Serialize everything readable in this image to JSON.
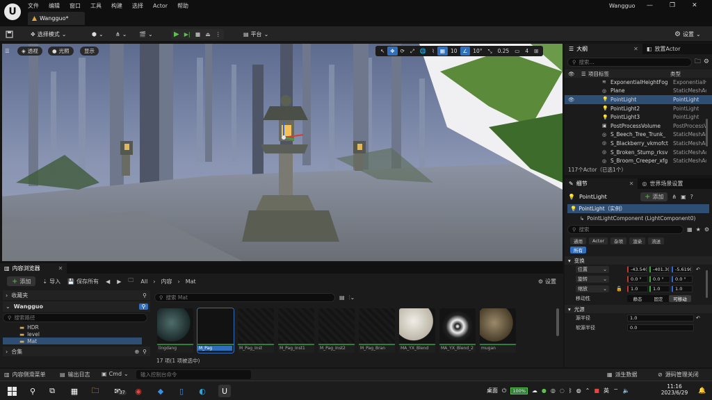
{
  "app": {
    "menu": [
      "文件",
      "编辑",
      "窗口",
      "工具",
      "构建",
      "选择",
      "Actor",
      "帮助"
    ],
    "doc_tab": "Wangguo*",
    "project_name": "Wangguo"
  },
  "toolbar": {
    "select_mode": "选择模式",
    "platform": "平台",
    "settings": "设置"
  },
  "viewport": {
    "perspective": "透视",
    "lit": "光照",
    "show": "显示",
    "grid_snap": "10",
    "rot_snap": "10°",
    "scale_snap": "0.25",
    "camera_speed": "4"
  },
  "outliner": {
    "tab_outliner": "大纲",
    "tab_place": "放置Actor",
    "search_placeholder": "搜索...",
    "col_label": "项目标签",
    "col_type": "类型",
    "rows": [
      {
        "name": "ExponentialHeightFog",
        "type": "ExponentialHeightFog",
        "icon": "fog-icon"
      },
      {
        "name": "Plane",
        "type": "StaticMeshActor",
        "icon": "mesh-icon"
      },
      {
        "name": "PointLight",
        "type": "PointLight",
        "icon": "light-icon",
        "selected": true
      },
      {
        "name": "PointLight2",
        "type": "PointLight",
        "icon": "light-icon"
      },
      {
        "name": "PointLight3",
        "type": "PointLight",
        "icon": "light-icon"
      },
      {
        "name": "PostProcessVolume",
        "type": "PostProcessVolume",
        "icon": "volume-icon"
      },
      {
        "name": "S_Beech_Tree_Trunk_",
        "type": "StaticMeshActor",
        "icon": "mesh-icon"
      },
      {
        "name": "S_Blackberry_vkmofct",
        "type": "StaticMeshActor",
        "icon": "mesh-icon"
      },
      {
        "name": "S_Broken_Stump_rksv",
        "type": "StaticMeshActor",
        "icon": "mesh-icon"
      },
      {
        "name": "S_Broom_Creeper_xfg",
        "type": "StaticMeshActor",
        "icon": "mesh-icon"
      }
    ],
    "count": "117个Actor（已选1个）"
  },
  "details": {
    "tab_details": "细节",
    "tab_world": "世界场景设置",
    "actor_name": "PointLight",
    "add_label": "添加",
    "instance_label": "PointLight（实例）",
    "component_label": "PointLightComponent (LightComponent0)",
    "search_placeholder": "搜索",
    "categories": [
      "通用",
      "Actor",
      "杂项",
      "渲染",
      "流送",
      "所有"
    ],
    "transform_title": "变换",
    "location_label": "位置",
    "rotation_label": "旋转",
    "scale_label": "缩放",
    "location": [
      "-43.54(",
      "-401.3(",
      "-5.619("
    ],
    "rotation": [
      "0.0 °",
      "0.0 °",
      "0.0 °"
    ],
    "scale": [
      "1.0",
      "1.0",
      "1.0"
    ],
    "mobility_label": "移动性",
    "mobility": [
      "静态",
      "固定",
      "可移动"
    ],
    "light_title": "光源",
    "source_radius_label": "源半径",
    "source_radius": "1.0",
    "soft_radius_label": "软源半径",
    "soft_radius": "0.0"
  },
  "content_browser": {
    "tab": "内容浏览器",
    "add": "添加",
    "import": "导入",
    "save_all": "保存所有",
    "path": [
      "All",
      "内容",
      "Mat"
    ],
    "settings": "设置",
    "favorites": "收藏夹",
    "project": "Wangguo",
    "path_search": "搜索路径",
    "folders": [
      "HDR",
      "level",
      "Mat"
    ],
    "collections": "合集",
    "asset_search": "搜索 Mat",
    "assets": [
      "lingdang",
      "M_Pag",
      "M_Pag_Inst",
      "M_Pag_Inst1",
      "M_Pag_Inst2",
      "M_Pag_Bran",
      "MA_YX_Blend",
      "MA_YX_Blend_2",
      "mugan"
    ],
    "status": "17 项(1 项被选中)"
  },
  "statusbar": {
    "drawer": "内容侧滑菜单",
    "output_log": "输出日志",
    "cmd": "Cmd",
    "cmd_placeholder": "输入控制台命令",
    "derived_data": "派生数据",
    "source_control": "源码管理关闭"
  },
  "taskbar": {
    "desktop": "桌面",
    "battery": "100%",
    "time": "11:16",
    "date": "2023/6/29",
    "mail_badge": "37"
  }
}
